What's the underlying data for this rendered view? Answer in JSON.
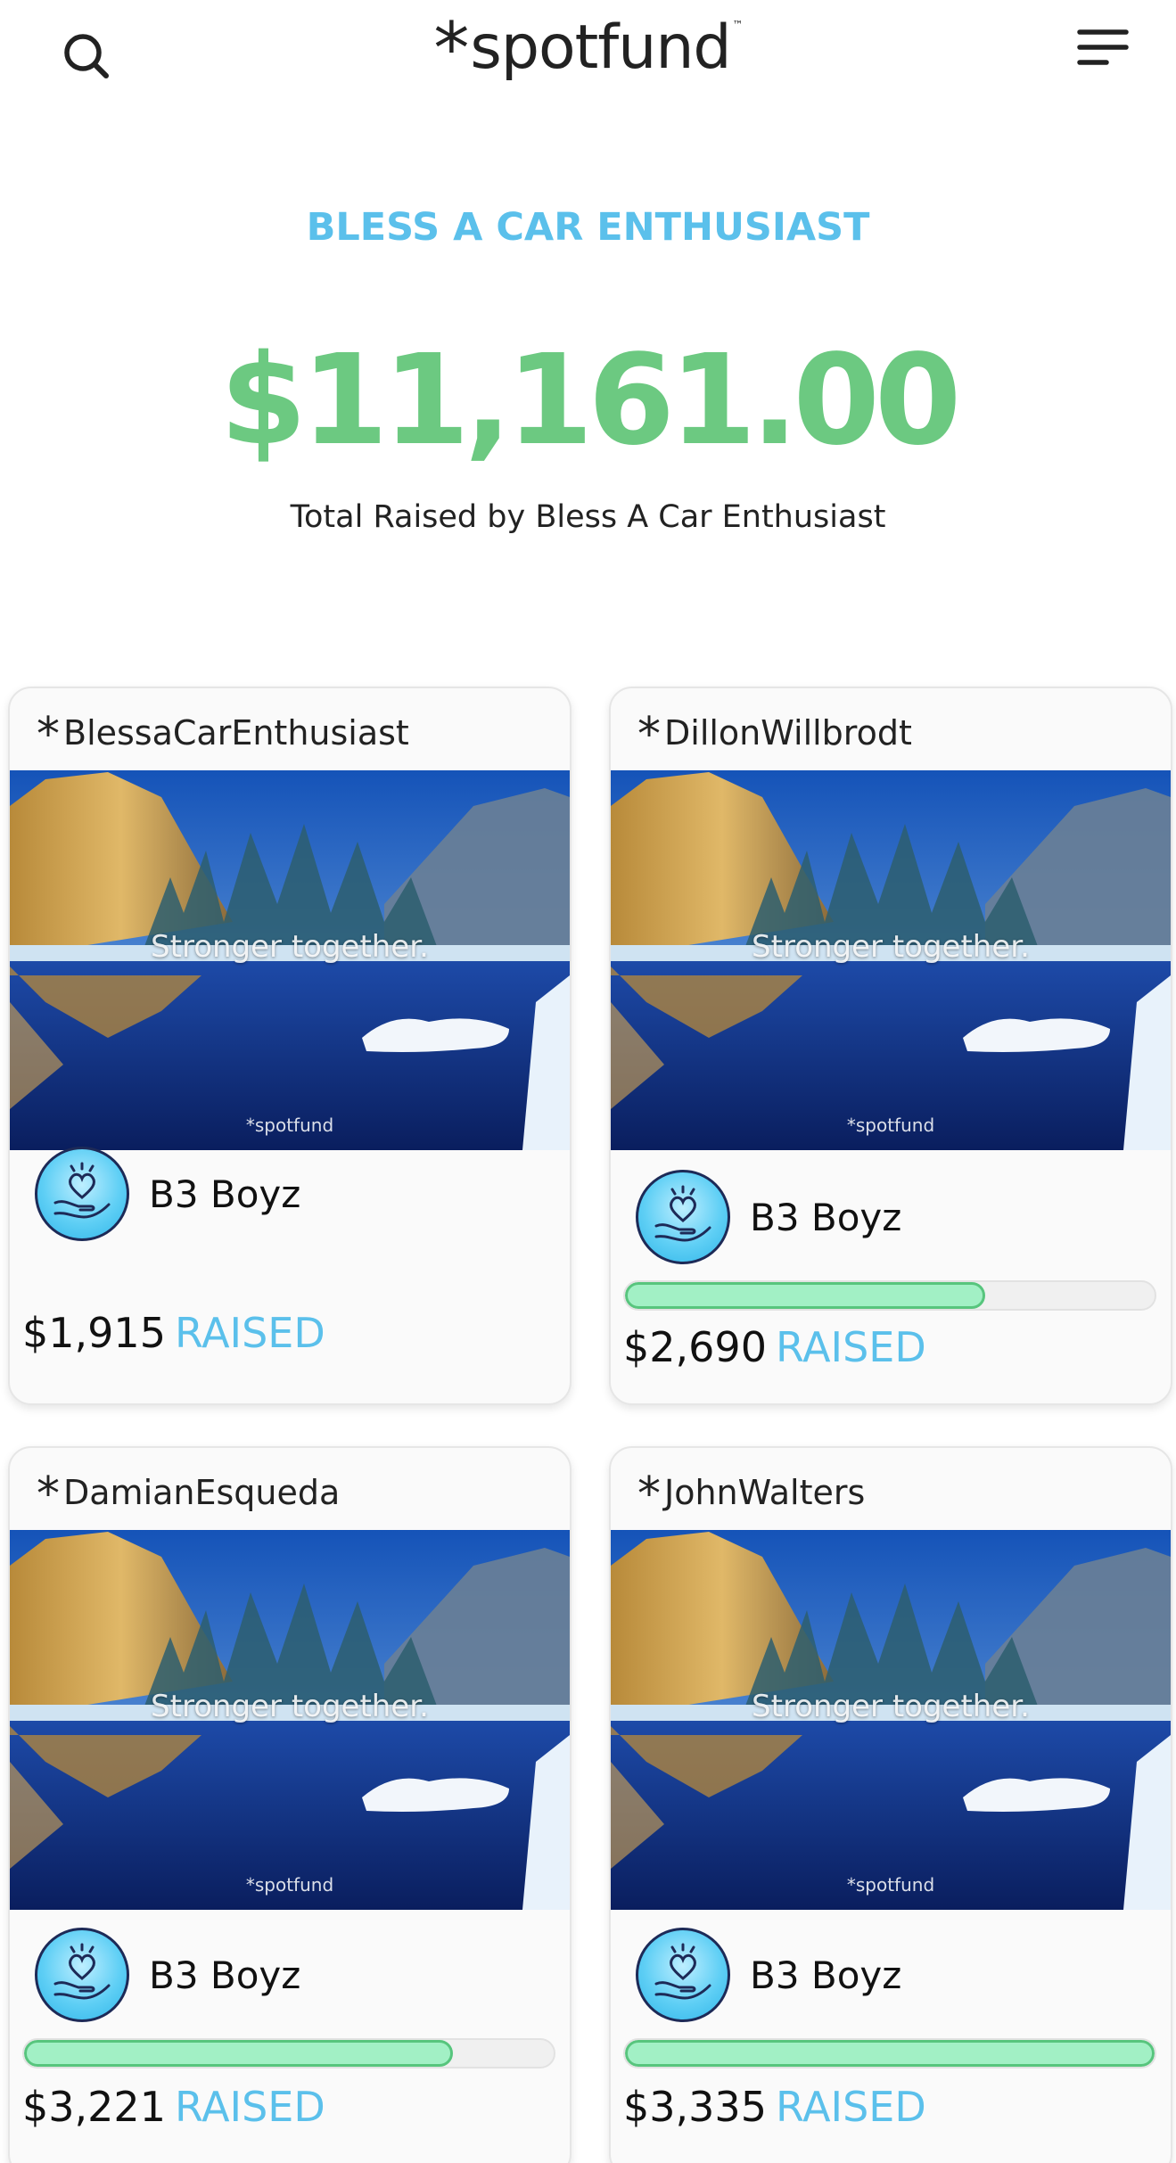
{
  "header": {
    "logo_star": "*",
    "logo_text": "spotfund",
    "logo_tm": "™"
  },
  "campaign": {
    "title": "BLESS A CAR ENTHUSIAST",
    "total_amount": "$11,161.00",
    "total_label": "Total Raised by Bless A Car Enthusiast"
  },
  "colors": {
    "accent_blue": "#5bc0eb",
    "amount_green": "#6cc981",
    "progress_fill": "#a2f0c5",
    "progress_border": "#57c57d"
  },
  "cards": [
    {
      "handle": "BlessaCarEnthusiast",
      "image_caption": "Stronger together.",
      "image_watermark": "*spotfund",
      "team_name": "B3 Boyz",
      "raised_amount": "$1,915",
      "raised_word": "RAISED",
      "progress": null
    },
    {
      "handle": "DillonWillbrodt",
      "image_caption": "Stronger together.",
      "image_watermark": "*spotfund",
      "team_name": "B3 Boyz",
      "raised_amount": "$2,690",
      "raised_word": "RAISED",
      "progress": 0.68
    },
    {
      "handle": "DamianEsqueda",
      "image_caption": "Stronger together.",
      "image_watermark": "*spotfund",
      "team_name": "B3 Boyz",
      "raised_amount": "$3,221",
      "raised_word": "RAISED",
      "progress": 0.81
    },
    {
      "handle": "JohnWalters",
      "image_caption": "Stronger together.",
      "image_watermark": "*spotfund",
      "team_name": "B3 Boyz",
      "raised_amount": "$3,335",
      "raised_word": "RAISED",
      "progress": 1.0
    }
  ]
}
